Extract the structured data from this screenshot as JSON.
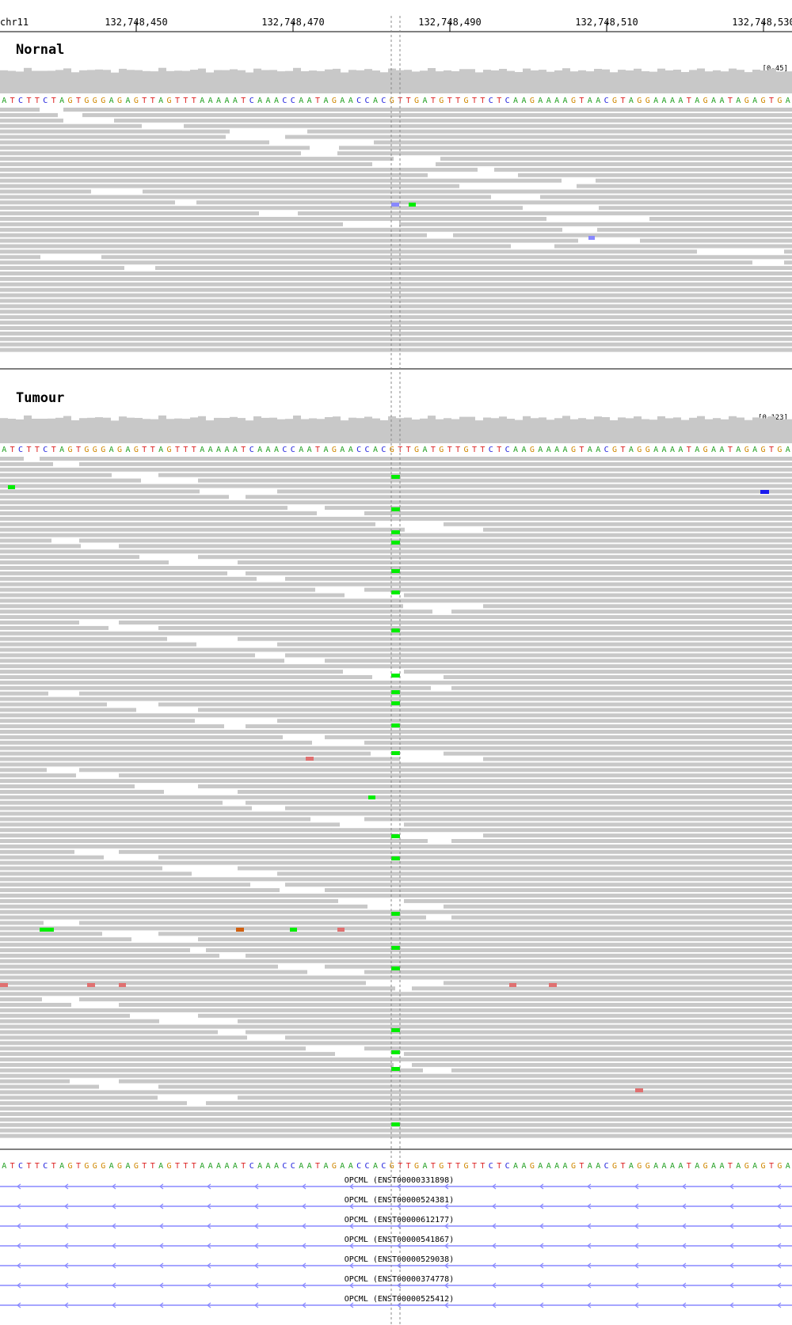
{
  "ruler": {
    "chrom": "chr11",
    "ticks": [
      "132,748,450",
      "132,748,470",
      "132,748,490",
      "132,748,510",
      "132,748,530"
    ]
  },
  "reference_sequence": "ATCTTCTAGTGGGAGAGTTAGTTTAAAAATCAAACCAATAGAACCACGTTGATGTTGTTCTCAAGAAAAGTAACGTAGGAAAATAGAATAGAGTGA",
  "tracks": [
    {
      "title": "Nornal",
      "range": "[0-45]"
    },
    {
      "title": "Tumour",
      "range": "[0-123]"
    }
  ],
  "genes": [
    "OPCML (ENST00000331898)",
    "OPCML (ENST00000524381)",
    "OPCML (ENST00000612177)",
    "OPCML (ENST00000541867)",
    "OPCML (ENST00000529038)",
    "OPCML (ENST00000374778)",
    "OPCML (ENST00000525412)"
  ],
  "colors": {
    "read": "#c8c8c8",
    "coverage": "#c8c8c8",
    "A": "#22a022",
    "C": "#2222dd",
    "G": "#d08800",
    "T": "#dd2222",
    "mismatch_green": "#00ee00",
    "mismatch_blue": "#1a1aee",
    "mismatch_red": "#e07070",
    "mismatch_orange": "#d06010",
    "gene_line": "#8888ff",
    "center_line": "#999999"
  }
}
